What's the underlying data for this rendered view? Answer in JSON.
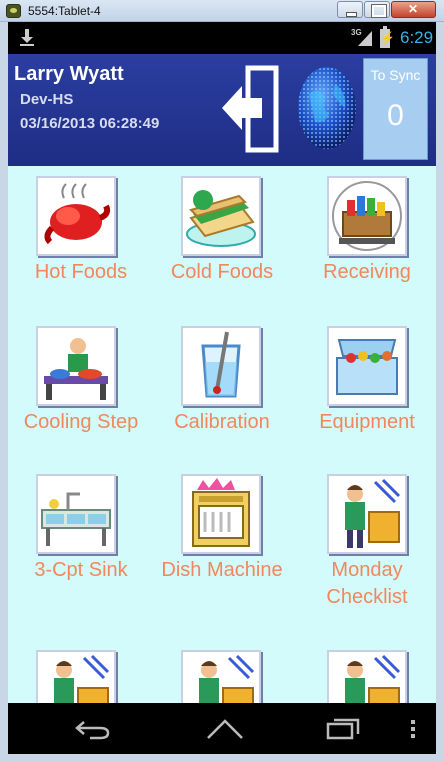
{
  "window": {
    "title": "5554:Tablet-4",
    "icon": "emulator-icon"
  },
  "status_bar": {
    "network": "3G",
    "time": "6:29",
    "icons": [
      "download-icon",
      "signal-icon",
      "battery-charging-icon"
    ]
  },
  "header": {
    "user_name": "Larry Wyatt",
    "organization": "Dev-HS",
    "datetime": "03/16/2013 06:28:49",
    "sync_label": "To Sync",
    "sync_count": "0",
    "icons": [
      "logout-icon",
      "globe-icon"
    ]
  },
  "tiles": [
    {
      "label": "Hot Foods",
      "icon": "hot-foods-icon"
    },
    {
      "label": "Cold Foods",
      "icon": "cold-foods-icon"
    },
    {
      "label": "Receiving",
      "icon": "receiving-icon"
    },
    {
      "label": "Cooling Step",
      "icon": "cooling-step-icon"
    },
    {
      "label": "Calibration",
      "icon": "calibration-icon"
    },
    {
      "label": "Equipment",
      "icon": "equipment-icon"
    },
    {
      "label": "3-Cpt Sink",
      "icon": "sink-icon"
    },
    {
      "label": "Dish Machine",
      "icon": "dish-machine-icon"
    },
    {
      "label": "Monday Checklist",
      "icon": "checklist-icon"
    },
    {
      "label": "",
      "icon": "checklist-icon"
    },
    {
      "label": "",
      "icon": "checklist-icon"
    },
    {
      "label": "",
      "icon": "checklist-icon"
    }
  ],
  "nav_bar": {
    "buttons": [
      "back-icon",
      "home-icon",
      "recent-apps-icon",
      "menu-icon"
    ]
  },
  "colors": {
    "header_bg": "#2b3ea0",
    "grid_bg": "#d4fbfb",
    "tile_label": "#f2875e",
    "sync_box": "#a7cef0",
    "clock": "#33b5e5"
  }
}
